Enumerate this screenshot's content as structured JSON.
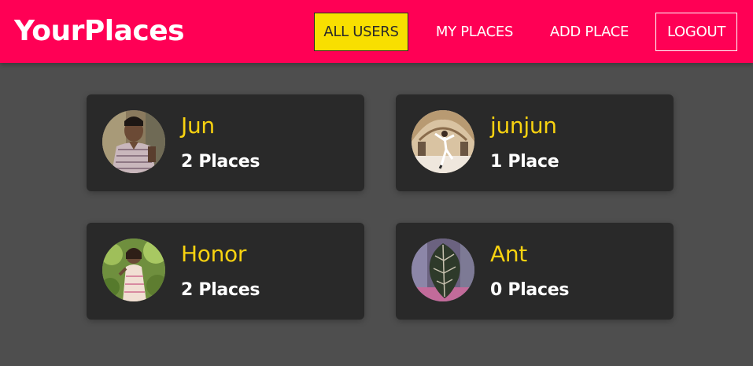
{
  "app": {
    "title": "YourPlaces"
  },
  "nav": {
    "all_users": "ALL USERS",
    "my_places": "MY PLACES",
    "add_place": "ADD PLACE",
    "logout": "LOGOUT"
  },
  "colors": {
    "header": "#ff0055",
    "active_nav": "#f8df00",
    "name": "#f8d210",
    "card": "#292929",
    "background": "#4e4e4e"
  },
  "users": [
    {
      "name": "Jun",
      "places": "2 Places",
      "avatar": "man-photo"
    },
    {
      "name": "junjun",
      "places": "1 Place",
      "avatar": "dancer-photo"
    },
    {
      "name": "Honor",
      "places": "2 Places",
      "avatar": "child-photo"
    },
    {
      "name": "Ant",
      "places": "0 Places",
      "avatar": "leaf-photo"
    }
  ]
}
